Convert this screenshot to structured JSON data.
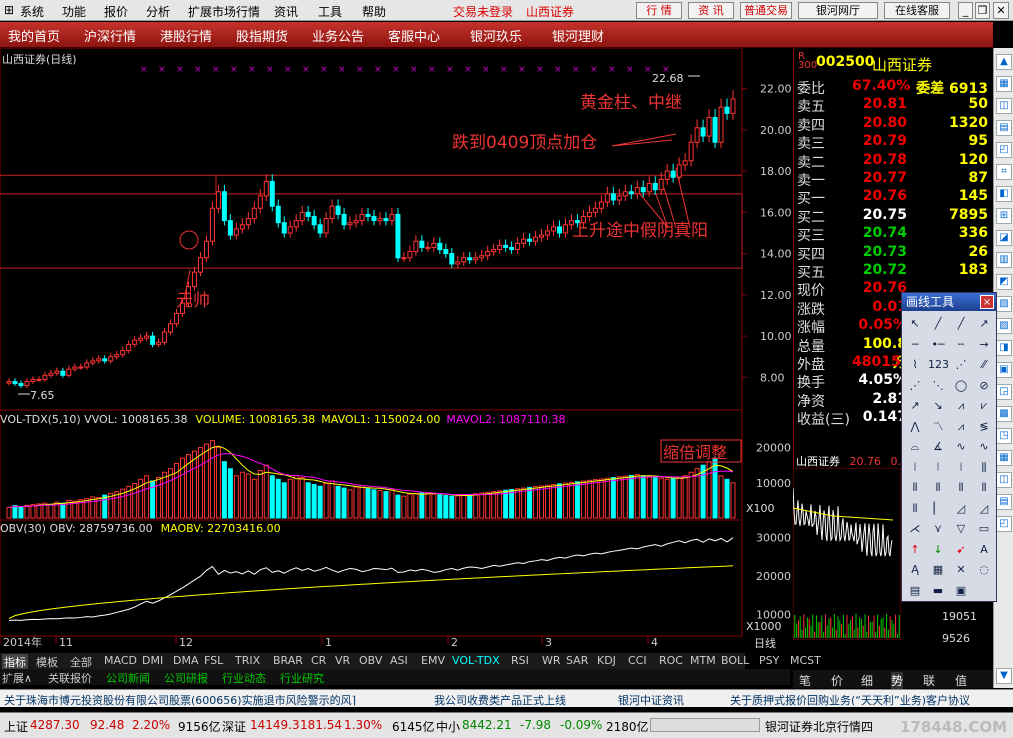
{
  "menu": {
    "items": [
      "系统",
      "功能",
      "报价",
      "分析",
      "扩展市场行情",
      "资讯",
      "工具",
      "帮助"
    ],
    "login_status": "交易未登录",
    "broker": "山西证券",
    "buttons": [
      "行 情",
      "资 讯",
      "普通交易",
      "银河网厅",
      "在线客服"
    ]
  },
  "nav": {
    "items": [
      "我的首页",
      "沪深行情",
      "港股行情",
      "股指期货",
      "业务公告",
      "客服中心",
      "银河玖乐",
      "银河理财"
    ]
  },
  "chart": {
    "title": "山西证券(日线)",
    "annotations": {
      "a1": "黄金柱、中继",
      "a2": "跌到0409顶点加仓",
      "a3": "上升途中假阴真阳",
      "a4": "元帅",
      "a5": "缩倍调整",
      "high": "22.68",
      "low": "7.65"
    },
    "price_axis": [
      "22.00",
      "20.00",
      "18.00",
      "16.00",
      "14.00",
      "12.00",
      "10.00",
      "8.00"
    ],
    "vol_line": {
      "label": "VOL-TDX(5,10) VVOL: 1008165.38",
      "volume": "VOLUME: 1008165.38",
      "mavol1": "MAVOL1: 1150024.00",
      "mavol2": "MAVOL2: 1087110.38"
    },
    "vol_axis": [
      "20000",
      "10000"
    ],
    "vol_unit": "X100",
    "obv_line": {
      "label": "OBV(30) OBV: 28759736.00",
      "maobv": "MAOBV: 22703416.00"
    },
    "obv_axis": [
      "30000",
      "20000",
      "10000"
    ],
    "obv_unit": "X1000",
    "date_axis": [
      "2014年",
      "11",
      "12",
      "1",
      "2",
      "3",
      "4"
    ],
    "period": "日线"
  },
  "chart_data": {
    "type": "candlestick",
    "title": "山西证券(日线)",
    "price_high": 22.68,
    "price_low": 7.65,
    "ylim": [
      7,
      23
    ],
    "volume_ylim": [
      0,
      25000
    ],
    "obv_ylim": [
      5000,
      32000
    ],
    "x_labels": [
      "2014年",
      "11",
      "12",
      "1",
      "2",
      "3",
      "4"
    ],
    "hlines": [
      17.8,
      16.9,
      13.3
    ],
    "close": [
      7.8,
      7.7,
      7.6,
      7.8,
      7.9,
      7.9,
      8.1,
      8.2,
      8.3,
      8.1,
      8.4,
      8.5,
      8.5,
      8.7,
      8.8,
      8.9,
      8.8,
      9.0,
      9.1,
      9.3,
      9.6,
      9.8,
      9.9,
      10.0,
      9.6,
      9.7,
      10.2,
      10.6,
      11.1,
      11.6,
      12.4,
      13.1,
      13.8,
      14.6,
      16.2,
      17.0,
      15.6,
      14.9,
      15.2,
      15.4,
      15.7,
      16.2,
      16.8,
      17.5,
      16.3,
      15.5,
      15.0,
      15.3,
      15.6,
      16.0,
      15.8,
      15.4,
      15.0,
      15.7,
      16.3,
      15.9,
      15.4,
      15.5,
      15.6,
      15.9,
      15.8,
      15.6,
      15.7,
      15.6,
      15.9,
      13.8,
      13.8,
      14.1,
      14.6,
      14.3,
      14.3,
      14.5,
      14.2,
      14.0,
      13.5,
      13.6,
      13.8,
      13.7,
      13.8,
      13.9,
      14.1,
      14.2,
      14.4,
      14.3,
      14.2,
      14.5,
      14.7,
      14.6,
      14.8,
      14.9,
      15.1,
      15.3,
      15.0,
      15.4,
      15.6,
      15.5,
      15.8,
      16.0,
      16.2,
      16.5,
      16.9,
      16.6,
      16.8,
      17.0,
      16.9,
      17.2,
      17.0,
      17.4,
      17.1,
      17.6,
      18.0,
      17.7,
      18.3,
      18.5,
      19.4,
      20.1,
      19.7,
      20.6,
      19.4,
      21.1,
      20.8,
      21.5
    ],
    "volume": [
      3000,
      3500,
      3200,
      3600,
      3800,
      4000,
      4200,
      3900,
      4500,
      4200,
      5000,
      4800,
      5200,
      5500,
      6000,
      5800,
      6500,
      7000,
      7500,
      8200,
      9000,
      9800,
      11000,
      12000,
      10500,
      11500,
      13000,
      14000,
      15500,
      17000,
      18000,
      19000,
      20000,
      21000,
      22000,
      20000,
      16000,
      14000,
      12000,
      13000,
      12500,
      11000,
      13500,
      15000,
      12000,
      11000,
      10000,
      11000,
      12000,
      11500,
      10000,
      9500,
      9000,
      9800,
      10500,
      9000,
      8500,
      8000,
      8800,
      9200,
      8500,
      8000,
      7800,
      7500,
      8000,
      6500,
      6200,
      6800,
      7000,
      7200,
      7000,
      6800,
      6600,
      6400,
      6200,
      6300,
      6500,
      6700,
      6900,
      7100,
      7300,
      7500,
      7700,
      7900,
      8100,
      8300,
      8500,
      8700,
      8900,
      9100,
      9300,
      9500,
      9700,
      9900,
      10100,
      10300,
      10500,
      10700,
      10900,
      11100,
      11300,
      11500,
      11700,
      11900,
      12100,
      12300,
      12000,
      11800,
      11500,
      11300,
      11000,
      11200,
      11500,
      12000,
      13000,
      14000,
      15000,
      16000,
      17000,
      12000,
      11000,
      10000
    ],
    "obv": [
      8500,
      8600,
      8550,
      8700,
      8800,
      8750,
      8900,
      9000,
      8950,
      9100,
      9200,
      9150,
      9300,
      9500,
      9400,
      9700,
      9900,
      10200,
      10600,
      11000,
      11400,
      12000,
      12800,
      13500,
      13000,
      13600,
      14400,
      15200,
      16100,
      17000,
      18000,
      19000,
      20000,
      21500,
      22500,
      20500,
      21500,
      20800,
      21200,
      20600,
      21400,
      20500,
      21700,
      22200,
      21000,
      21400,
      20800,
      21600,
      22200,
      21500,
      22000,
      21300,
      21700,
      22300,
      21600,
      21000,
      21600,
      22000,
      21800,
      21200,
      21500,
      22000,
      21900,
      21700,
      22100,
      21000,
      21100,
      21600,
      21400,
      21800,
      21500,
      21000,
      21200,
      21700,
      22000,
      21600,
      22100,
      22400,
      22300,
      22000,
      22400,
      22800,
      22600,
      22900,
      23200,
      23500,
      23300,
      23800,
      24000,
      24300,
      24100,
      24600,
      24900,
      24700,
      25200,
      25500,
      25300,
      25700,
      26000,
      25800,
      26200,
      26500,
      26700,
      27000,
      27300,
      27100,
      27600,
      27900,
      28200,
      27800,
      28400,
      28800,
      29200,
      28700,
      29300,
      29600,
      28800,
      29700,
      29200,
      29800,
      28900,
      30000
    ],
    "maobv_start": 9000,
    "maobv_end": 22703,
    "vol_series": {
      "VOLUME": 1008165.38,
      "MAVOL1": 1150024.0,
      "MAVOL2": 1087110.38
    },
    "obv_series": {
      "OBV": 28759736.0,
      "MAOBV": 22703416.0
    }
  },
  "quote": {
    "code": "002500",
    "name": "山西证券",
    "r_label": "R",
    "r_sub": "300",
    "rows": [
      {
        "l": "委比",
        "p": "67.40%",
        "v": "委差 6913",
        "pc": "#e00"
      },
      {
        "l": "卖五",
        "p": "20.81",
        "v": "50",
        "pc": "#e00"
      },
      {
        "l": "卖四",
        "p": "20.80",
        "v": "1320",
        "pc": "#e00"
      },
      {
        "l": "卖三",
        "p": "20.79",
        "v": "95",
        "pc": "#e00"
      },
      {
        "l": "卖二",
        "p": "20.78",
        "v": "120",
        "pc": "#e00"
      },
      {
        "l": "卖一",
        "p": "20.77",
        "v": "87",
        "pc": "#e00"
      },
      {
        "l": "买一",
        "p": "20.76",
        "v": "145",
        "pc": "#e00"
      },
      {
        "l": "买二",
        "p": "20.75",
        "v": "7895",
        "pc": "#fff"
      },
      {
        "l": "买三",
        "p": "20.74",
        "v": "336",
        "pc": "#0c0"
      },
      {
        "l": "买四",
        "p": "20.73",
        "v": "26",
        "pc": "#0c0"
      },
      {
        "l": "买五",
        "p": "20.72",
        "v": "183",
        "pc": "#0c0"
      },
      {
        "l": "现价",
        "p": "20.76",
        "v": "",
        "pc": "#e00"
      },
      {
        "l": "涨跌",
        "p": "0.01",
        "v": "",
        "pc": "#e00"
      },
      {
        "l": "涨幅",
        "p": "0.05%",
        "v": "",
        "pc": "#e00"
      },
      {
        "l": "总量",
        "p": "100.8万",
        "v": "",
        "pc": "#ff0"
      },
      {
        "l": "外盘",
        "p": "480151",
        "v": "",
        "pc": "#e00"
      },
      {
        "l": "换手",
        "p": "4.05%",
        "v": "",
        "pc": "#fff"
      },
      {
        "l": "净资",
        "p": "2.81",
        "v": "",
        "pc": "#fff"
      },
      {
        "l": "收益(三)",
        "p": "0.147",
        "v": "",
        "pc": "#fff"
      }
    ],
    "mini_label": "山西证券",
    "mini_price": "20.76",
    "mini_extra": "0.01",
    "mini_axis": [
      "19051",
      "9526"
    ],
    "tabs": [
      "笔",
      "价",
      "细",
      "势",
      "联",
      "值"
    ]
  },
  "palette": {
    "title": "画线工具",
    "close": "×"
  },
  "tabs": {
    "items": [
      "指标",
      "模板",
      "全部",
      "MACD",
      "DMI",
      "DMA",
      "FSL",
      "TRIX",
      "BRAR",
      "CR",
      "VR",
      "OBV",
      "ASI",
      "EMV",
      "VOL-TDX",
      "RSI",
      "WR",
      "SAR",
      "KDJ",
      "CCI",
      "ROC",
      "MTM",
      "BOLL",
      "PSY",
      "MCST"
    ]
  },
  "subtabs": {
    "items": [
      "扩展∧",
      "关联报价",
      "公司新闻",
      "公司研报",
      "行业动态",
      "行业研究"
    ]
  },
  "ticker": {
    "items": [
      "关于珠海市博元投资股份有限公司股票(600656)实施退市风险警示的风⌉",
      "我公司收费类产品正式上线",
      "银河中证资讯",
      "关于质押式报价回购业务(“天天利”业务)客户协议"
    ]
  },
  "status": {
    "sh_label": "上证",
    "sh": "4287.30",
    "sh_chg": "92.48",
    "sh_pct": "2.20%",
    "sh_amt": "9156亿",
    "sz_label": "深证",
    "sz": "14149.3",
    "sz_chg": "181.54",
    "sz_pct": "1.30%",
    "sz_amt": "6145亿",
    "zx_label": "中小",
    "zx": "8442.21",
    "zx_chg": "-7.98",
    "zx_pct": "-0.09%",
    "zx_amt": "2180亿",
    "broker": "银河证券北京行情四",
    "wm": "178448.COM"
  }
}
